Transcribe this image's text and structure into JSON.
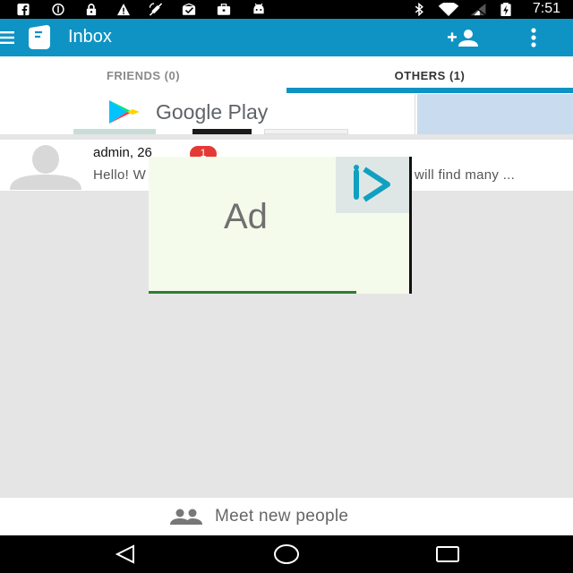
{
  "statusbar": {
    "time": "7:51",
    "left_icons": [
      "facebook-icon",
      "blocked-icon",
      "lock-icon",
      "warning-icon",
      "no-satellite-icon",
      "mail-check-icon",
      "briefcase-icon",
      "android-icon"
    ],
    "right_icons": [
      "bluetooth-icon",
      "wifi-icon",
      "signal-icon",
      "battery-charging-icon"
    ]
  },
  "appbar": {
    "title": "Inbox",
    "icons": [
      "menu-icon",
      "app-logo",
      "add-person-icon",
      "more-vert-icon"
    ]
  },
  "tabs": [
    {
      "label": "FRIENDS (0)",
      "selected": false
    },
    {
      "label": "OTHERS (1)",
      "selected": true
    }
  ],
  "banner": {
    "store_name": "Google Play"
  },
  "messages": [
    {
      "name": "admin, 26",
      "unread": "1",
      "preview_start": "Hello! W",
      "preview_end": "will find many ..."
    }
  ],
  "ad_overlay": {
    "label": "Ad"
  },
  "bottom": {
    "meet_label": "Meet new people"
  },
  "colors": {
    "primary": "#0e93c4",
    "badge": "#e53935",
    "background": "#e5e5e5"
  }
}
